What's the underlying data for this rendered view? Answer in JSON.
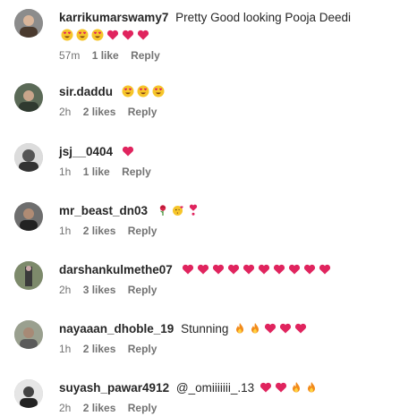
{
  "comments": [
    {
      "username": "karrikumarswamy7",
      "text": "Pretty Good looking Pooja Deedi",
      "emojis": [
        "heart-eyes",
        "heart-eyes",
        "heart-eyes",
        "red-heart",
        "red-heart",
        "red-heart"
      ],
      "time": "57m",
      "likes": "1 like",
      "reply": "Reply",
      "avatar": "avatar-photo"
    },
    {
      "username": "sir.daddu",
      "text": "",
      "emojis": [
        "heart-eyes",
        "heart-eyes",
        "heart-eyes"
      ],
      "time": "2h",
      "likes": "2 likes",
      "reply": "Reply",
      "avatar": "avatar-photo"
    },
    {
      "username": "jsj__0404",
      "text": "",
      "emojis": [
        "red-heart"
      ],
      "time": "1h",
      "likes": "1 like",
      "reply": "Reply",
      "avatar": "avatar-photo"
    },
    {
      "username": "mr_beast_dn03",
      "text": "",
      "emojis": [
        "rose",
        "kiss-heart",
        "heart-exclamation"
      ],
      "time": "1h",
      "likes": "2 likes",
      "reply": "Reply",
      "avatar": "avatar-photo"
    },
    {
      "username": "darshankulmethe07",
      "text": "",
      "emojis": [
        "red-heart",
        "red-heart",
        "red-heart",
        "red-heart",
        "red-heart",
        "red-heart",
        "red-heart",
        "red-heart",
        "red-heart",
        "red-heart"
      ],
      "time": "2h",
      "likes": "3 likes",
      "reply": "Reply",
      "avatar": "avatar-photo"
    },
    {
      "username": "nayaaan_dhoble_19",
      "text": "Stunning",
      "emojis": [
        "fire",
        "fire",
        "red-heart",
        "red-heart",
        "red-heart"
      ],
      "time": "1h",
      "likes": "2 likes",
      "reply": "Reply",
      "avatar": "avatar-photo"
    },
    {
      "username": "suyash_pawar4912",
      "text": "@_omiiiiiii_.13",
      "emojis": [
        "red-heart",
        "red-heart",
        "fire",
        "fire"
      ],
      "time": "2h",
      "likes": "2 likes",
      "reply": "Reply",
      "avatar": "avatar-photo"
    }
  ],
  "colors": {
    "heart": "#e0245e",
    "fire": "#f28a1a",
    "meta_text": "#737373",
    "username": "#262626"
  }
}
